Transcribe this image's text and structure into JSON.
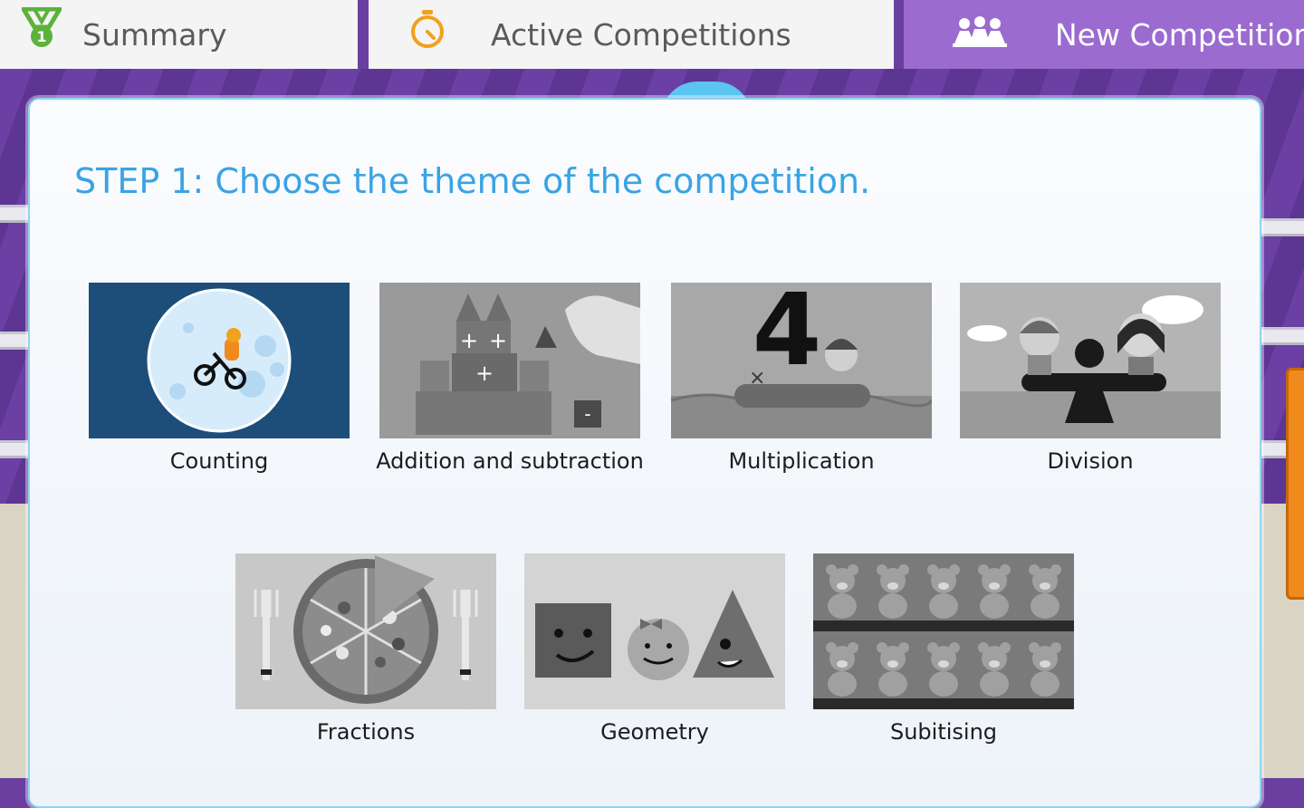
{
  "tabs": {
    "summary": "Summary",
    "active": "Active Competitions",
    "new": "New Competition"
  },
  "step": {
    "title": "STEP 1: Choose the theme of the competition."
  },
  "themes": [
    {
      "label": "Counting",
      "icon": "moon-bike-icon"
    },
    {
      "label": "Addition and subtraction",
      "icon": "blocks-castle-icon"
    },
    {
      "label": "Multiplication",
      "icon": "number-four-icon"
    },
    {
      "label": "Division",
      "icon": "seesaw-icon"
    },
    {
      "label": "Fractions",
      "icon": "pizza-icon"
    },
    {
      "label": "Geometry",
      "icon": "shapes-icon"
    },
    {
      "label": "Subitising",
      "icon": "teddy-bears-icon"
    }
  ],
  "colors": {
    "accent": "#3aa3e3",
    "tab_selected": "#9b6bd0",
    "background": "#6a3fa0",
    "counting_bg": "#1d4e7a"
  }
}
